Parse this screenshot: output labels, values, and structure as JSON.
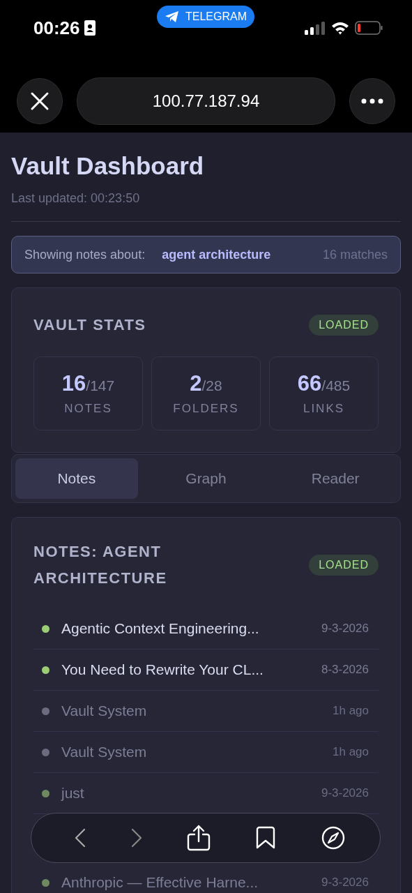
{
  "status_bar": {
    "time": "00:26",
    "app_badge": "TELEGRAM"
  },
  "browser": {
    "url": "100.77.187.94"
  },
  "header": {
    "title": "Vault Dashboard",
    "last_updated": "Last updated: 00:23:50"
  },
  "filter": {
    "label": "Showing notes about:",
    "topic": "agent architecture",
    "count": "16 matches"
  },
  "stats": {
    "title": "VAULT STATS",
    "status": "LOADED",
    "items": [
      {
        "value": "16",
        "total": "/147",
        "label": "NOTES"
      },
      {
        "value": "2",
        "total": "/28",
        "label": "FOLDERS"
      },
      {
        "value": "66",
        "total": "/485",
        "label": "LINKS"
      }
    ]
  },
  "tabs": [
    {
      "label": "Notes",
      "selected": true
    },
    {
      "label": "Graph",
      "selected": false
    },
    {
      "label": "Reader",
      "selected": false
    }
  ],
  "notes": {
    "title": "NOTES: AGENT ARCHITECTURE",
    "status": "LOADED",
    "items": [
      {
        "title": "Agentic Context Engineering...",
        "date": "9-3-2026",
        "color": "#9ccc74",
        "muted": false
      },
      {
        "title": "You Need to Rewrite Your CL...",
        "date": "8-3-2026",
        "color": "#9ccc74",
        "muted": false
      },
      {
        "title": "Vault System",
        "date": "1h ago",
        "color": "#6c6c80",
        "muted": true
      },
      {
        "title": "Vault System",
        "date": "1h ago",
        "color": "#6c6c80",
        "muted": true
      },
      {
        "title": "just",
        "date": "9-3-2026",
        "color": "#6f8a5e",
        "muted": true
      },
      {
        "title": "Anthropic — Effective Harne...",
        "date": "9-3-2026",
        "color": "#6f8a5e",
        "muted": true
      }
    ]
  }
}
